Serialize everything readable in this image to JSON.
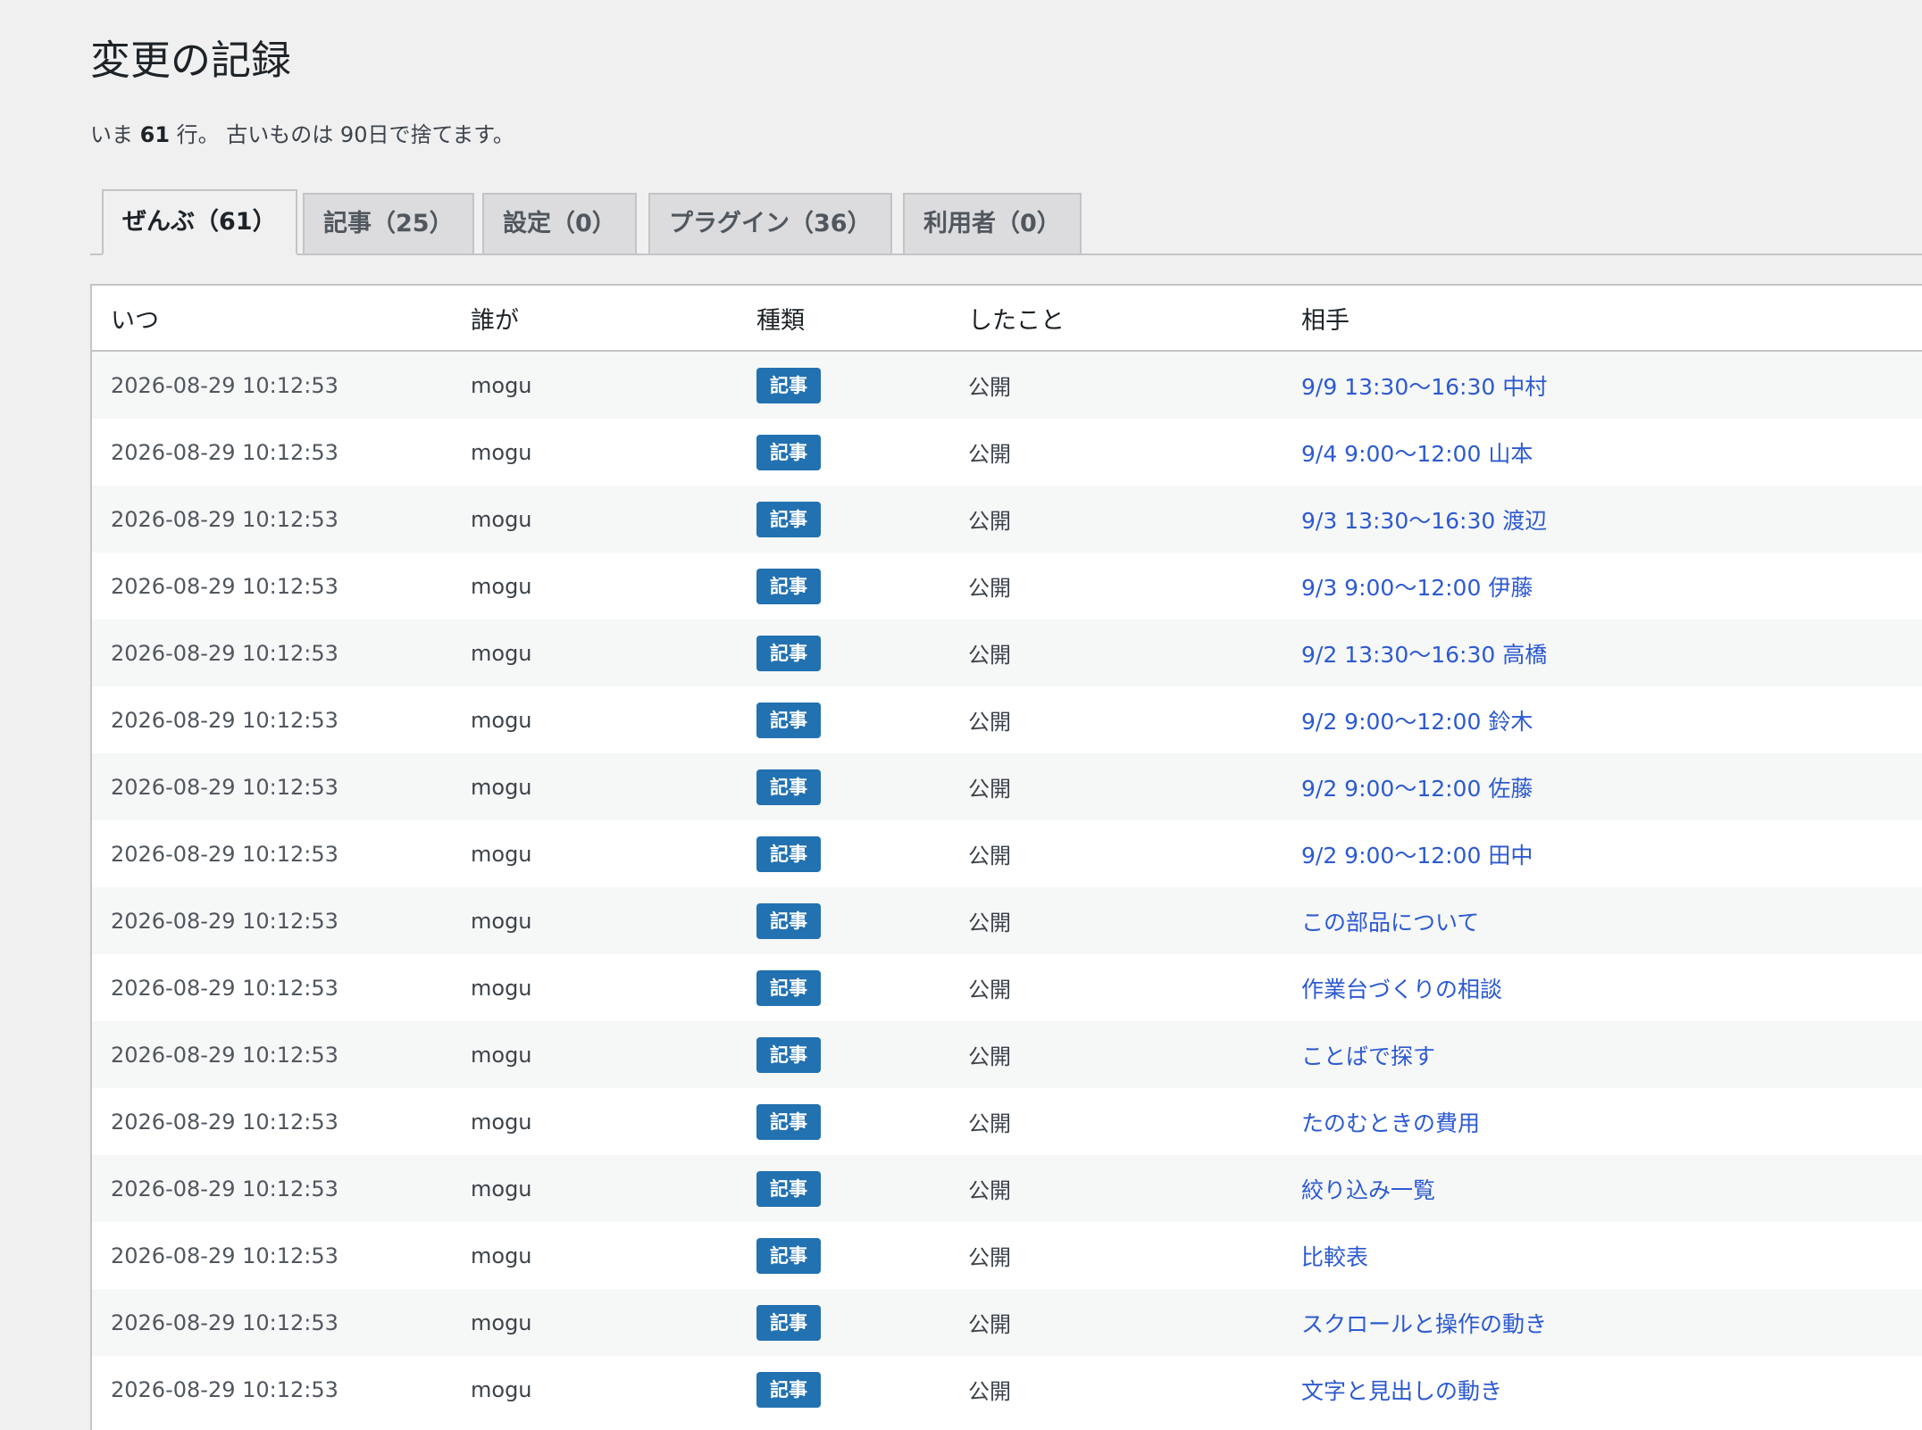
{
  "page": {
    "title": "変更の記録",
    "summary_prefix": "いま ",
    "summary_count": "61",
    "summary_suffix": " 行。 古いものは 90日で捨てます。"
  },
  "tabs": [
    {
      "label": "ぜんぶ（61）",
      "active": true
    },
    {
      "label": "記事（25）",
      "active": false
    },
    {
      "label": "設定（0）",
      "active": false
    },
    {
      "label": "プラグイン（36）",
      "active": false
    },
    {
      "label": "利用者（0）",
      "active": false
    }
  ],
  "table": {
    "columns": [
      "いつ",
      "誰が",
      "種類",
      "したこと",
      "相手"
    ],
    "rows": [
      {
        "when": "2026-08-29 10:12:53",
        "who": "mogu",
        "type": "記事",
        "action": "公開",
        "target": "9/9 13:30〜16:30 中村"
      },
      {
        "when": "2026-08-29 10:12:53",
        "who": "mogu",
        "type": "記事",
        "action": "公開",
        "target": "9/4 9:00〜12:00 山本"
      },
      {
        "when": "2026-08-29 10:12:53",
        "who": "mogu",
        "type": "記事",
        "action": "公開",
        "target": "9/3 13:30〜16:30 渡辺"
      },
      {
        "when": "2026-08-29 10:12:53",
        "who": "mogu",
        "type": "記事",
        "action": "公開",
        "target": "9/3 9:00〜12:00 伊藤"
      },
      {
        "when": "2026-08-29 10:12:53",
        "who": "mogu",
        "type": "記事",
        "action": "公開",
        "target": "9/2 13:30〜16:30 高橋"
      },
      {
        "when": "2026-08-29 10:12:53",
        "who": "mogu",
        "type": "記事",
        "action": "公開",
        "target": "9/2 9:00〜12:00 鈴木"
      },
      {
        "when": "2026-08-29 10:12:53",
        "who": "mogu",
        "type": "記事",
        "action": "公開",
        "target": "9/2 9:00〜12:00 佐藤"
      },
      {
        "when": "2026-08-29 10:12:53",
        "who": "mogu",
        "type": "記事",
        "action": "公開",
        "target": "9/2 9:00〜12:00 田中"
      },
      {
        "when": "2026-08-29 10:12:53",
        "who": "mogu",
        "type": "記事",
        "action": "公開",
        "target": "この部品について"
      },
      {
        "when": "2026-08-29 10:12:53",
        "who": "mogu",
        "type": "記事",
        "action": "公開",
        "target": "作業台づくりの相談"
      },
      {
        "when": "2026-08-29 10:12:53",
        "who": "mogu",
        "type": "記事",
        "action": "公開",
        "target": "ことばで探す"
      },
      {
        "when": "2026-08-29 10:12:53",
        "who": "mogu",
        "type": "記事",
        "action": "公開",
        "target": "たのむときの費用"
      },
      {
        "when": "2026-08-29 10:12:53",
        "who": "mogu",
        "type": "記事",
        "action": "公開",
        "target": "絞り込み一覧"
      },
      {
        "when": "2026-08-29 10:12:53",
        "who": "mogu",
        "type": "記事",
        "action": "公開",
        "target": "比較表"
      },
      {
        "when": "2026-08-29 10:12:53",
        "who": "mogu",
        "type": "記事",
        "action": "公開",
        "target": "スクロールと操作の動き"
      },
      {
        "when": "2026-08-29 10:12:53",
        "who": "mogu",
        "type": "記事",
        "action": "公開",
        "target": "文字と見出しの動き"
      }
    ]
  }
}
